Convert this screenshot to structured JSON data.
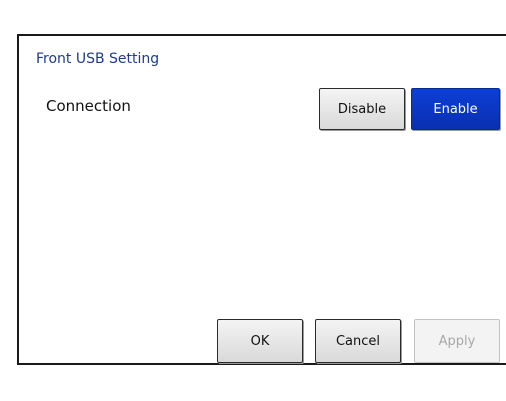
{
  "dialog": {
    "title": "Front USB Setting"
  },
  "connection": {
    "label": "Connection",
    "options": [
      "Disable",
      "Enable"
    ],
    "selected": "Enable"
  },
  "footer": {
    "ok_label": "OK",
    "cancel_label": "Cancel",
    "apply_label": "Apply",
    "apply_enabled": false
  },
  "colors": {
    "accent": "#0a2fb0",
    "title_text": "#1f3b8c",
    "disabled_text": "#a8a8a8"
  }
}
